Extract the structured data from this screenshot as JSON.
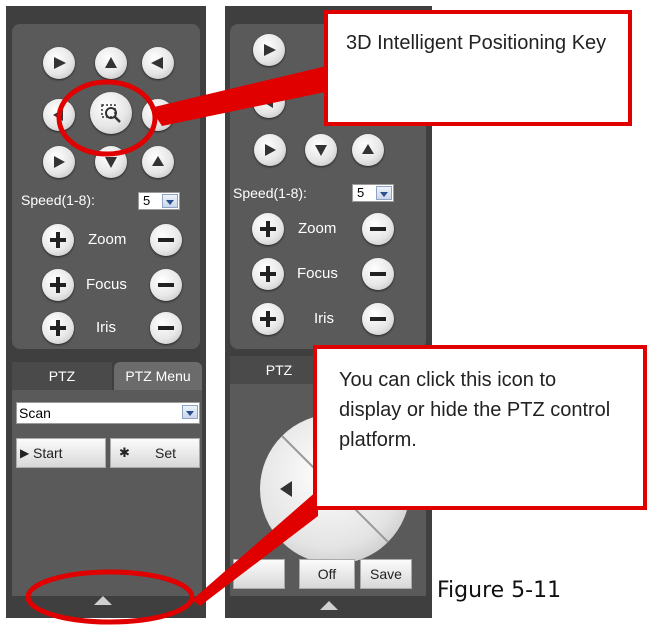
{
  "left_panel": {
    "speed_label": "Speed(1-8):",
    "speed_value": "5",
    "zoom_label": "Zoom",
    "focus_label": "Focus",
    "iris_label": "Iris",
    "tab_ptz": "PTZ",
    "tab_ptz_menu": "PTZ Menu",
    "scan_value": "Scan",
    "start_label": "Start",
    "set_label": "Set"
  },
  "right_panel": {
    "speed_label": "Speed(1-8):",
    "speed_value": "5",
    "zoom_label": "Zoom",
    "focus_label": "Focus",
    "iris_label": "Iris",
    "tab_ptz": "PTZ",
    "off_label": "Off",
    "save_label": "Save"
  },
  "callouts": {
    "top": "3D Intelligent Positioning Key",
    "bottom": "You can click this icon to display or hide the PTZ control platform."
  },
  "caption": "Figure 5-11",
  "colors": {
    "panel": "#3f3f3f",
    "panel_inner": "#5a5a5a",
    "highlight": "#e00000"
  }
}
